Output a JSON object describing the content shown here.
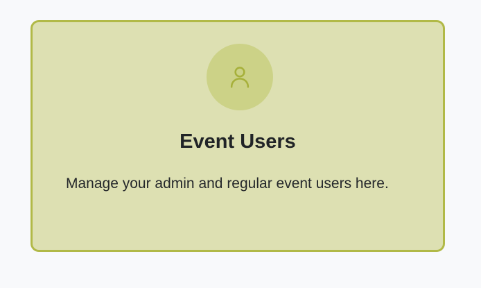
{
  "card": {
    "icon": "user-icon",
    "title": "Event Users",
    "description": "Manage your admin and regular event users here."
  },
  "colors": {
    "card_background": "#dde0b2",
    "card_border": "#b1b947",
    "icon_circle": "#ccd287",
    "icon_stroke": "#a6b03a",
    "page_background": "#f8f9fb"
  }
}
